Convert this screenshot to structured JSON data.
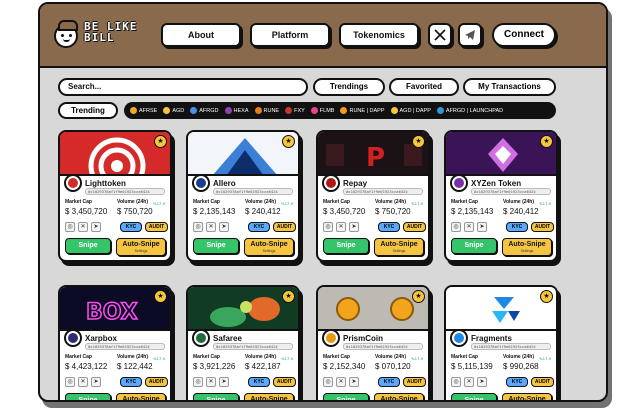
{
  "header": {
    "logo_text": "BE LIKE BILL",
    "nav": [
      "About",
      "Platform",
      "Tokenomics"
    ],
    "x_icon": "x-logo-icon",
    "telegram_icon": "telegram-icon",
    "connect_label": "Connect"
  },
  "filters": {
    "search_placeholder": "Search...",
    "tabs": [
      "Trendings",
      "Favorited",
      "My Transactions"
    ],
    "trending_label": "Trending"
  },
  "ticker": [
    {
      "label": "AFRSE",
      "color": "#f5a623"
    },
    {
      "label": "AGD",
      "color": "#f5c542"
    },
    {
      "label": "AFRGD",
      "color": "#4a90e2"
    },
    {
      "label": "HEXA",
      "color": "#8e44ad"
    },
    {
      "label": "RUNE",
      "color": "#e67e22"
    },
    {
      "label": "FXY",
      "color": "#c0392b"
    },
    {
      "label": "FLMB",
      "color": "#e84393"
    },
    {
      "label": "RUNE | DAPP",
      "color": "#f39c12"
    },
    {
      "label": "AGD | DAPP",
      "color": "#f5c542"
    },
    {
      "label": "AFRGD | LAUNCHPAD",
      "color": "#3498db"
    }
  ],
  "card_labels": {
    "market_cap": "Market Cap",
    "volume": "Volume (24h)",
    "kyc": "KYC",
    "audit": "AUDIT",
    "snipe": "Snipe",
    "auto_snipe": "Auto-Snipe",
    "settings": "Settings"
  },
  "cards": [
    {
      "name": "Lighttoken",
      "address": "0x1029378af1f9e01923cca6424",
      "market_cap": "$ 3,450,720",
      "volume": "$ 750,720",
      "change": "%17.9",
      "theme": "red",
      "avatar_color": "#d42a2a"
    },
    {
      "name": "Allero",
      "address": "0x1029378af1f9e01923cca6424",
      "market_cap": "$ 2,135,143",
      "volume": "$ 240,412",
      "change": "%17.9",
      "theme": "blue",
      "avatar_color": "#1b3d8f"
    },
    {
      "name": "Repay",
      "address": "0x1029378af1f9e01923cca6424",
      "market_cap": "$ 3,450,720",
      "volume": "$ 750,720",
      "change": "%17.9",
      "theme": "dark",
      "avatar_color": "#b01818"
    },
    {
      "name": "XYZen Token",
      "address": "0x1029378af1f9e01923cca6424",
      "market_cap": "$ 2,135,143",
      "volume": "$ 240,412",
      "change": "%17.9",
      "theme": "purple",
      "avatar_color": "#7a2fa8"
    },
    {
      "name": "Xarpbox",
      "address": "0x1029378af1f9e01923cca6424",
      "market_cap": "$ 4,423,122",
      "volume": "$ 122,442",
      "change": "%17.9",
      "theme": "neon",
      "avatar_color": "#2b2b7a"
    },
    {
      "name": "Safaree",
      "address": "0x1029378af1f9e01923cca6424",
      "market_cap": "$ 3,921,226",
      "volume": "$ 422,187",
      "change": "%17.9",
      "theme": "green",
      "avatar_color": "#1f6b3a"
    },
    {
      "name": "PrismCoin",
      "address": "0x1029378af1f9e01923cca6424",
      "market_cap": "$ 2,152,340",
      "volume": "$ 070,120",
      "change": "%17.9",
      "theme": "coin",
      "avatar_color": "#e59a13"
    },
    {
      "name": "Fragments",
      "address": "0x1029378af1f9e01923cca6424",
      "market_cap": "$ 5,115,139",
      "volume": "$ 990,268",
      "change": "%17.9",
      "theme": "white",
      "avatar_color": "#1e88e5"
    }
  ]
}
